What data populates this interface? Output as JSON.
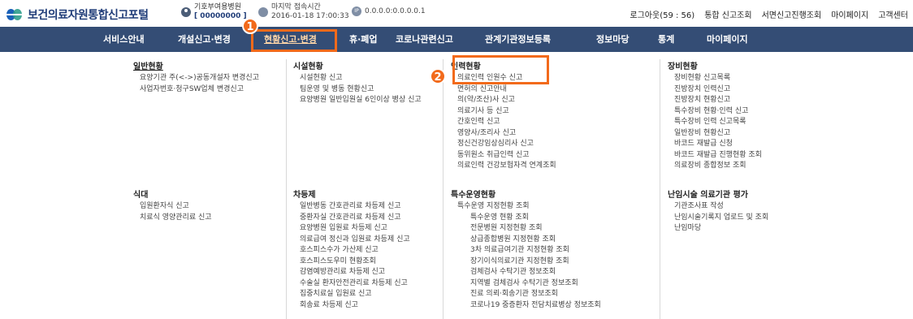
{
  "header": {
    "logo_text": "보건의료자원통합신고포털",
    "user_org": "기호부여용병원",
    "user_id": "[ 00000000 ]",
    "last_access_label": "마지막 접속시간",
    "last_access_time": "2016-01-18 17:00:33",
    "ip_address": "0.0.0.0:0.0.0.0.1",
    "links": [
      "로그아웃(59 : 56)",
      "통합 신고조회",
      "서면신고진행조회",
      "마이페이지",
      "고객센터"
    ]
  },
  "nav": {
    "items": [
      "서비스안내",
      "개설신고·변경",
      "현황신고·변경",
      "휴·폐업",
      "코로나관련신고",
      "관계기관정보등록",
      "정보마당",
      "통계",
      "마이페이지"
    ],
    "active": "현황신고·변경"
  },
  "annotations": {
    "badge1": "1",
    "badge2": "2"
  },
  "menu": {
    "col1": {
      "g1": {
        "title": "일반현황",
        "items": [
          "요양기관 주(<->)공동개설자 변경신고",
          "사업자번호·청구SW업체 변경신고"
        ]
      },
      "g2": {
        "title": "식대",
        "items": [
          "입원환자식 신고",
          "치료식 영양관리료 신고"
        ]
      }
    },
    "col2": {
      "g1": {
        "title": "시설현황",
        "items": [
          "시설현황 신고",
          "팀운영 및 병동 현황신고",
          "요양병원 일반입원실 6인이상 병상 신고"
        ]
      },
      "g2": {
        "title": "차등제",
        "items": [
          "일반병동 간호관리료 차등제 신고",
          "중환자실 간호관리료 차등제 신고",
          "요양병원 입원료 차등제 신고",
          "의료급여 정신과 입원료 차등제 신고",
          "호스피스수가 가산제 신고",
          "호스피스도우미 현황조회",
          "감염예방관리료 차등제 신고",
          "수술실 환자안전관리료 차등제 신고",
          "집중치료실 입원료 신고",
          "회송료 차등제 신고"
        ]
      }
    },
    "col3": {
      "g1": {
        "title": "인력현황",
        "items": [
          "의료인력 인원수 신고",
          "면허의 신고안내",
          "의(약/조산)사 신고",
          "의료기사 등 신고",
          "간호인력 신고",
          "영양사/조리사 신고",
          "정신건강임상심리사 신고",
          "동위원소 취급인력 신고",
          "의료인력 건강보험자격 연계조회"
        ]
      },
      "g2": {
        "title": "특수운영현황",
        "items": [
          "특수운영 지정현황 조회"
        ],
        "subitems": [
          "특수운영 현황 조회",
          "전문병원 지정현황 조회",
          "상급종합병원 지정현황 조회",
          "3차 의료급여기관 지정현황 조회",
          "장기이식의료기관 지정현황 조회",
          "검체검사 수탁기관 정보조회",
          "지역별 검체검사 수탁기관 정보조회",
          "진료 의뢰·회송기관 정보조회",
          "코로나19 중증환자 전담치료병상 정보조회"
        ]
      }
    },
    "col4": {
      "g1": {
        "title": "장비현황",
        "items": [
          "장비현황 신고목록",
          "진방장치 인력신고",
          "진방장치 현황신고",
          "특수장비 현황·인력 신고",
          "특수장비 인력 신고목록",
          "일반장비 현황신고",
          "바코드 재발급 신청",
          "바코드 재발급 진행현황 조회",
          "의료장비 종합정보 조회"
        ]
      },
      "g2": {
        "title": "난임시술 의료기관 평가",
        "items": [
          "기관조사표 작성",
          "난임시술기록지 업로드 및 조회",
          "난임마당"
        ]
      }
    }
  }
}
